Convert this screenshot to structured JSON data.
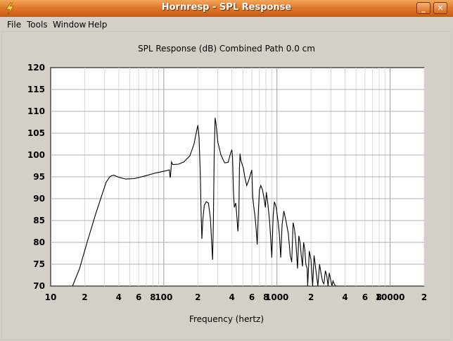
{
  "window": {
    "title": "Hornresp - SPL Response",
    "minimize_label": "_",
    "close_label": "✕"
  },
  "menu": [
    "File",
    "Tools",
    "Window",
    "Help"
  ],
  "chart_data": {
    "type": "line",
    "title": "SPL Response (dB)   Combined   Path 0.0 cm",
    "xlabel": "Frequency (hertz)",
    "ylabel": "",
    "xscale": "log",
    "xlim": [
      10,
      20000
    ],
    "ylim": [
      70,
      120
    ],
    "grid": true,
    "yticks": [
      "120",
      "115",
      "110",
      "105",
      "100",
      "95",
      "90",
      "85",
      "80",
      "75",
      "70"
    ],
    "xticks": [
      {
        "f": 10,
        "label": "10"
      },
      {
        "f": 20,
        "label": "2"
      },
      {
        "f": 40,
        "label": "4"
      },
      {
        "f": 60,
        "label": "6"
      },
      {
        "f": 80,
        "label": "8"
      },
      {
        "f": 100,
        "label": "100"
      },
      {
        "f": 200,
        "label": "2"
      },
      {
        "f": 400,
        "label": "4"
      },
      {
        "f": 600,
        "label": "6"
      },
      {
        "f": 800,
        "label": "8"
      },
      {
        "f": 1000,
        "label": "1000"
      },
      {
        "f": 2000,
        "label": "2"
      },
      {
        "f": 4000,
        "label": "4"
      },
      {
        "f": 6000,
        "label": "6"
      },
      {
        "f": 8000,
        "label": "8"
      },
      {
        "f": 10000,
        "label": "10000"
      },
      {
        "f": 20000,
        "label": "2"
      }
    ],
    "series": [
      {
        "points": [
          [
            15.6,
            70
          ],
          [
            18,
            74
          ],
          [
            21,
            80
          ],
          [
            25,
            86.5
          ],
          [
            28.5,
            91
          ],
          [
            31,
            93.8
          ],
          [
            33.5,
            95.1
          ],
          [
            36,
            95.4
          ],
          [
            40,
            94.9
          ],
          [
            46,
            94.5
          ],
          [
            55,
            94.6
          ],
          [
            68,
            95.2
          ],
          [
            85,
            95.9
          ],
          [
            105,
            96.4
          ],
          [
            112,
            96.6
          ],
          [
            113,
            95.6
          ],
          [
            114,
            94.8
          ],
          [
            115,
            95.6
          ],
          [
            117,
            98.4
          ],
          [
            120,
            97.8
          ],
          [
            135,
            97.9
          ],
          [
            150,
            98.4
          ],
          [
            170,
            99.8
          ],
          [
            185,
            102.5
          ],
          [
            195,
            105.5
          ],
          [
            200,
            106.8
          ],
          [
            205,
            104
          ],
          [
            210,
            96
          ],
          [
            214,
            86
          ],
          [
            217,
            80.8
          ],
          [
            221,
            85
          ],
          [
            228,
            88.5
          ],
          [
            238,
            89.3
          ],
          [
            248,
            89
          ],
          [
            258,
            85.5
          ],
          [
            265,
            80
          ],
          [
            270,
            76
          ],
          [
            274,
            84
          ],
          [
            279,
            100
          ],
          [
            284,
            108.5
          ],
          [
            290,
            107
          ],
          [
            300,
            103
          ],
          [
            320,
            100
          ],
          [
            345,
            98.2
          ],
          [
            370,
            98.3
          ],
          [
            390,
            100.5
          ],
          [
            400,
            101.2
          ],
          [
            406,
            99
          ],
          [
            412,
            92
          ],
          [
            420,
            88
          ],
          [
            433,
            89
          ],
          [
            442,
            86
          ],
          [
            452,
            82.5
          ],
          [
            460,
            86
          ],
          [
            466,
            97
          ],
          [
            472,
            100.3
          ],
          [
            480,
            98.8
          ],
          [
            505,
            97
          ],
          [
            520,
            95
          ],
          [
            540,
            93
          ],
          [
            560,
            94
          ],
          [
            590,
            96
          ],
          [
            600,
            96.6
          ],
          [
            610,
            90.5
          ],
          [
            625,
            88
          ],
          [
            640,
            86
          ],
          [
            655,
            83
          ],
          [
            670,
            79.5
          ],
          [
            685,
            87
          ],
          [
            700,
            92
          ],
          [
            720,
            93
          ],
          [
            745,
            92
          ],
          [
            770,
            90
          ],
          [
            790,
            88
          ],
          [
            805,
            91.5
          ],
          [
            830,
            89
          ],
          [
            860,
            85
          ],
          [
            880,
            81
          ],
          [
            900,
            76.5
          ],
          [
            925,
            86
          ],
          [
            950,
            89.3
          ],
          [
            985,
            88
          ],
          [
            1020,
            85
          ],
          [
            1050,
            82
          ],
          [
            1080,
            76.5
          ],
          [
            1110,
            84
          ],
          [
            1150,
            87.2
          ],
          [
            1200,
            85
          ],
          [
            1260,
            82
          ],
          [
            1310,
            77
          ],
          [
            1350,
            75.5
          ],
          [
            1390,
            84.5
          ],
          [
            1430,
            83
          ],
          [
            1470,
            80
          ],
          [
            1520,
            74
          ],
          [
            1560,
            81.5
          ],
          [
            1600,
            80
          ],
          [
            1640,
            77
          ],
          [
            1680,
            74.5
          ],
          [
            1720,
            80
          ],
          [
            1760,
            78.5
          ],
          [
            1800,
            75
          ],
          [
            1850,
            74
          ],
          [
            1870,
            70
          ],
          [
            1930,
            78
          ],
          [
            2000,
            76
          ],
          [
            2070,
            70
          ],
          [
            2130,
            77
          ],
          [
            2200,
            74
          ],
          [
            2300,
            70
          ],
          [
            2380,
            75
          ],
          [
            2450,
            73
          ],
          [
            2530,
            71
          ],
          [
            2600,
            70.5
          ],
          [
            2680,
            73.5
          ],
          [
            2750,
            72.5
          ],
          [
            2830,
            70
          ],
          [
            2900,
            73
          ],
          [
            2980,
            71.5
          ],
          [
            3060,
            70
          ],
          [
            3130,
            71.2
          ],
          [
            3220,
            70.4
          ],
          [
            3300,
            70
          ]
        ]
      }
    ]
  }
}
